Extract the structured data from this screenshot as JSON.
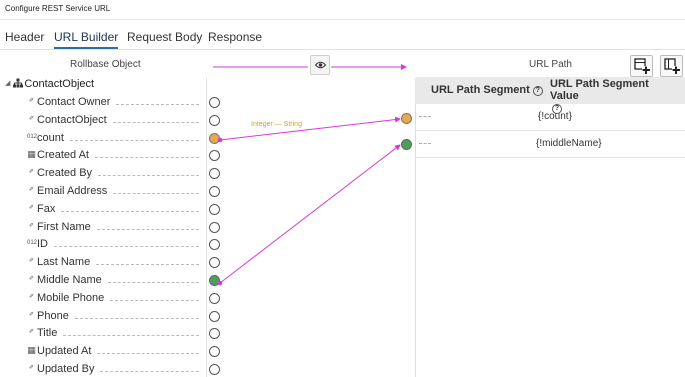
{
  "window": {
    "title": "Configure REST Service URL"
  },
  "tabs": [
    {
      "label": "Header",
      "active": false
    },
    {
      "label": "URL Builder",
      "active": true
    },
    {
      "label": "Request Body",
      "active": false
    },
    {
      "label": "Response",
      "active": false
    }
  ],
  "left_panel": {
    "title": "Rollbase Object"
  },
  "right_panel": {
    "title": "URL Path"
  },
  "tree": {
    "root": "ContactObject",
    "fields": [
      {
        "label": "Contact Owner",
        "icon": "text-field-icon",
        "port": "empty"
      },
      {
        "label": "ContactObject",
        "icon": "text-field-icon",
        "port": "empty"
      },
      {
        "label": "count",
        "icon": "number-field-icon",
        "port": "orange"
      },
      {
        "label": "Created At",
        "icon": "date-field-icon",
        "port": "empty"
      },
      {
        "label": "Created By",
        "icon": "text-field-icon",
        "port": "empty"
      },
      {
        "label": "Email Address",
        "icon": "text-field-icon",
        "port": "empty"
      },
      {
        "label": "Fax",
        "icon": "text-field-icon",
        "port": "empty"
      },
      {
        "label": "First Name",
        "icon": "text-field-icon",
        "port": "empty"
      },
      {
        "label": "ID",
        "icon": "number-field-icon",
        "port": "empty"
      },
      {
        "label": "Last Name",
        "icon": "text-field-icon",
        "port": "empty"
      },
      {
        "label": "Middle Name",
        "icon": "text-field-icon",
        "port": "green"
      },
      {
        "label": "Mobile Phone",
        "icon": "text-field-icon",
        "port": "empty"
      },
      {
        "label": "Phone",
        "icon": "text-field-icon",
        "port": "empty"
      },
      {
        "label": "Title",
        "icon": "text-field-icon",
        "port": "empty"
      },
      {
        "label": "Updated At",
        "icon": "date-field-icon",
        "port": "empty"
      },
      {
        "label": "Updated By",
        "icon": "text-field-icon",
        "port": "empty"
      }
    ]
  },
  "mapping": {
    "type_label": "Integer — String"
  },
  "grid": {
    "col1": "URL Path Segment",
    "col2": "URL Path Segment Value",
    "rows": [
      {
        "value": "{!count}",
        "port": "orange"
      },
      {
        "value": "{!middleName}",
        "port": "green"
      }
    ]
  },
  "colors": {
    "accent": "#2d6da8",
    "orange_port": "#e7a94a",
    "green_port": "#4da05b",
    "link_line": "#d63ad6",
    "type_label": "#e29a2b"
  },
  "icons": {
    "eye": "eye-icon",
    "add_row": "add-row-icon",
    "add_column": "add-column-icon",
    "tree_root": "object-tree-icon"
  }
}
